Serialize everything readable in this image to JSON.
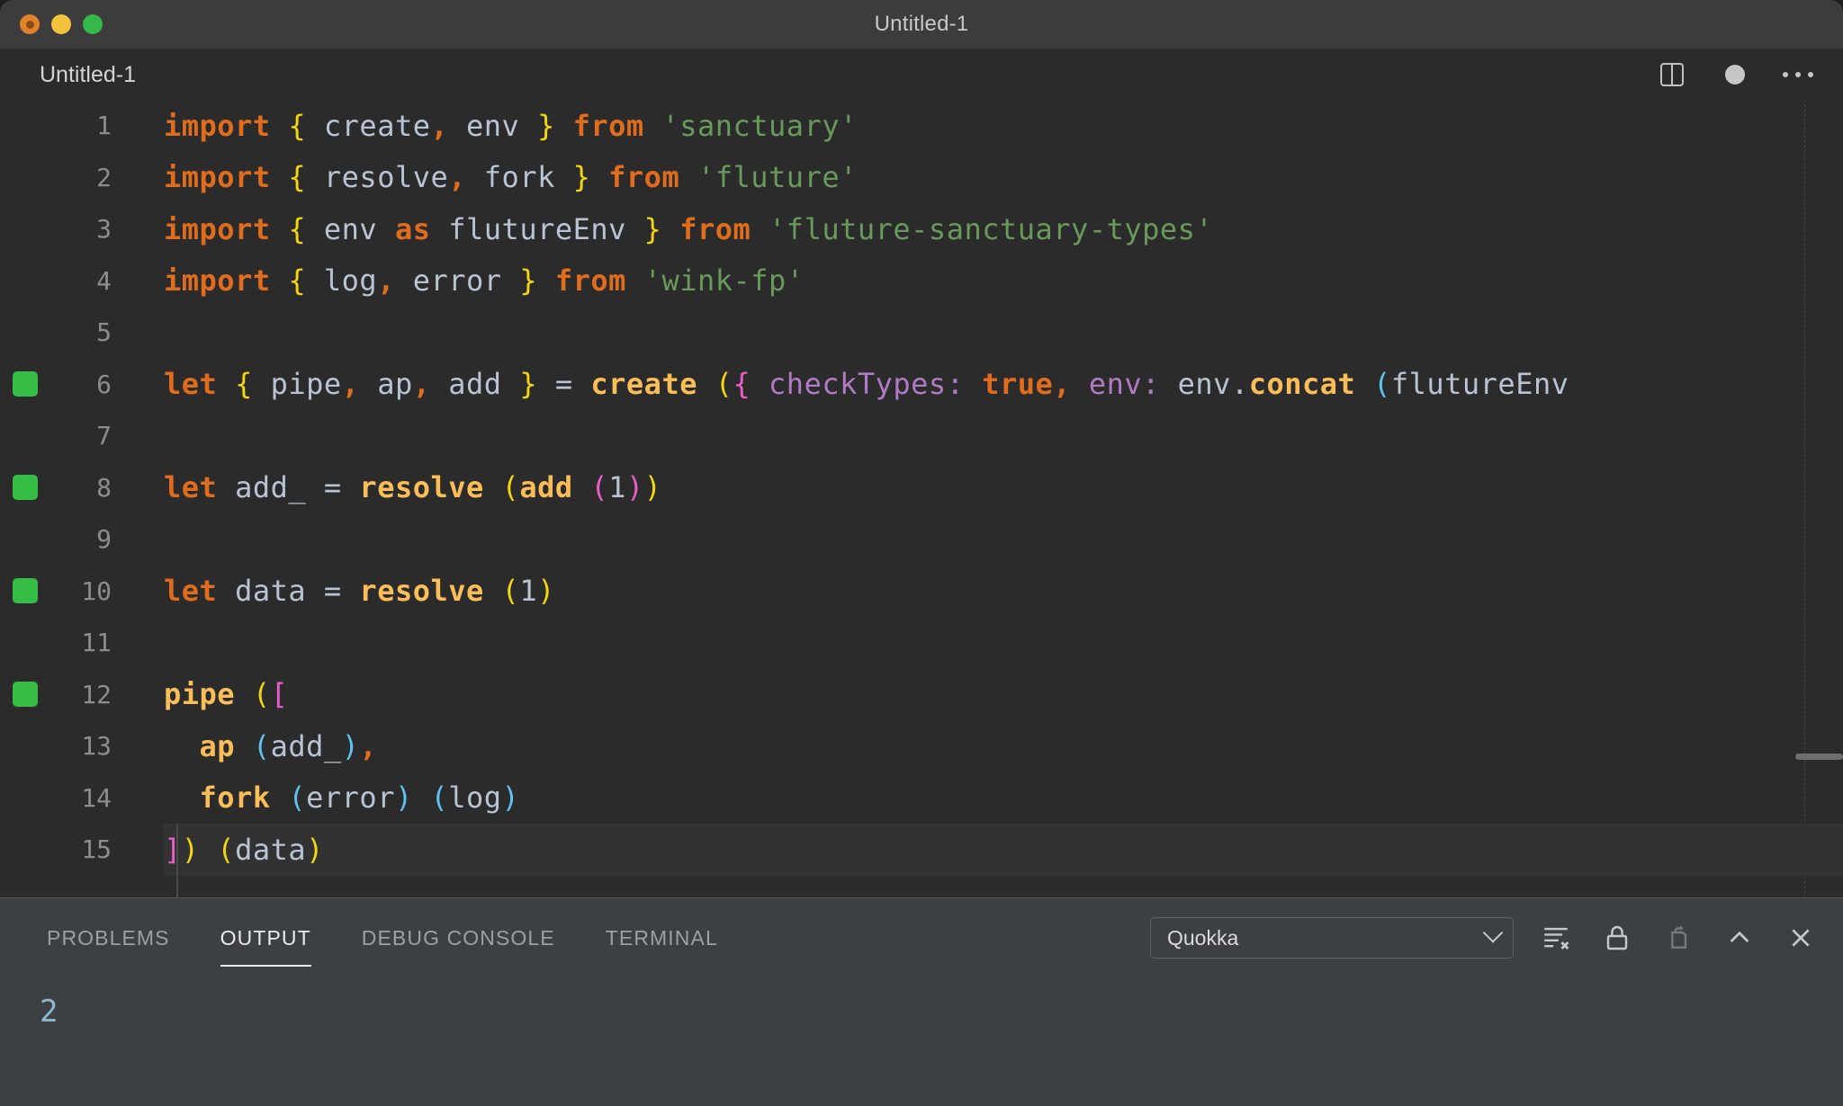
{
  "window": {
    "title": "Untitled-1",
    "traffic_lights": [
      {
        "name": "close",
        "color": "#e0822c"
      },
      {
        "name": "minimize",
        "color": "#f5c33b"
      },
      {
        "name": "maximize",
        "color": "#35b84a"
      }
    ]
  },
  "editor": {
    "tab_label": "Untitled-1",
    "actions": [
      {
        "name": "split-editor-icon",
        "label": "Split Editor"
      },
      {
        "name": "unsaved-indicator-icon",
        "label": "Unsaved"
      },
      {
        "name": "more-actions-icon",
        "label": "More Actions..."
      }
    ],
    "language": "javascript",
    "current_line": 15,
    "lines": [
      {
        "n": 1,
        "quokka": false,
        "tokens": [
          {
            "t": "import",
            "c": "t-kw"
          },
          {
            "t": " ",
            "c": "t-plain"
          },
          {
            "t": "{",
            "c": "b-yellow"
          },
          {
            "t": " create",
            "c": "t-plain"
          },
          {
            "t": ",",
            "c": "t-kw"
          },
          {
            "t": " env ",
            "c": "t-plain"
          },
          {
            "t": "}",
            "c": "b-yellow"
          },
          {
            "t": " ",
            "c": "t-plain"
          },
          {
            "t": "from",
            "c": "t-kw"
          },
          {
            "t": " ",
            "c": "t-plain"
          },
          {
            "t": "'sanctuary'",
            "c": "t-str"
          }
        ]
      },
      {
        "n": 2,
        "quokka": false,
        "tokens": [
          {
            "t": "import",
            "c": "t-kw"
          },
          {
            "t": " ",
            "c": "t-plain"
          },
          {
            "t": "{",
            "c": "b-yellow"
          },
          {
            "t": " resolve",
            "c": "t-plain"
          },
          {
            "t": ",",
            "c": "t-kw"
          },
          {
            "t": " fork ",
            "c": "t-plain"
          },
          {
            "t": "}",
            "c": "b-yellow"
          },
          {
            "t": " ",
            "c": "t-plain"
          },
          {
            "t": "from",
            "c": "t-kw"
          },
          {
            "t": " ",
            "c": "t-plain"
          },
          {
            "t": "'fluture'",
            "c": "t-str"
          }
        ]
      },
      {
        "n": 3,
        "quokka": false,
        "tokens": [
          {
            "t": "import",
            "c": "t-kw"
          },
          {
            "t": " ",
            "c": "t-plain"
          },
          {
            "t": "{",
            "c": "b-yellow"
          },
          {
            "t": " env ",
            "c": "t-plain"
          },
          {
            "t": "as",
            "c": "t-kw"
          },
          {
            "t": " flutureEnv ",
            "c": "t-plain"
          },
          {
            "t": "}",
            "c": "b-yellow"
          },
          {
            "t": " ",
            "c": "t-plain"
          },
          {
            "t": "from",
            "c": "t-kw"
          },
          {
            "t": " ",
            "c": "t-plain"
          },
          {
            "t": "'fluture-sanctuary-types'",
            "c": "t-str"
          }
        ]
      },
      {
        "n": 4,
        "quokka": false,
        "tokens": [
          {
            "t": "import",
            "c": "t-kw"
          },
          {
            "t": " ",
            "c": "t-plain"
          },
          {
            "t": "{",
            "c": "b-yellow"
          },
          {
            "t": " log",
            "c": "t-plain"
          },
          {
            "t": ",",
            "c": "t-kw"
          },
          {
            "t": " error ",
            "c": "t-plain"
          },
          {
            "t": "}",
            "c": "b-yellow"
          },
          {
            "t": " ",
            "c": "t-plain"
          },
          {
            "t": "from",
            "c": "t-kw"
          },
          {
            "t": " ",
            "c": "t-plain"
          },
          {
            "t": "'wink-fp'",
            "c": "t-str"
          }
        ]
      },
      {
        "n": 5,
        "quokka": false,
        "tokens": []
      },
      {
        "n": 6,
        "quokka": true,
        "tokens": [
          {
            "t": "let",
            "c": "t-kw"
          },
          {
            "t": " ",
            "c": "t-plain"
          },
          {
            "t": "{",
            "c": "b-yellow"
          },
          {
            "t": " pipe",
            "c": "t-plain"
          },
          {
            "t": ",",
            "c": "t-kw"
          },
          {
            "t": " ap",
            "c": "t-plain"
          },
          {
            "t": ",",
            "c": "t-kw"
          },
          {
            "t": " add ",
            "c": "t-plain"
          },
          {
            "t": "}",
            "c": "b-yellow"
          },
          {
            "t": " = ",
            "c": "t-op"
          },
          {
            "t": "create",
            "c": "t-fn"
          },
          {
            "t": " ",
            "c": "t-plain"
          },
          {
            "t": "(",
            "c": "b-yellow"
          },
          {
            "t": "{",
            "c": "b-magenta"
          },
          {
            "t": " ",
            "c": "t-plain"
          },
          {
            "t": "checkTypes",
            "c": "t-prop"
          },
          {
            "t": ": ",
            "c": "t-prop"
          },
          {
            "t": "true",
            "c": "t-kw"
          },
          {
            "t": ",",
            "c": "t-kw"
          },
          {
            "t": " ",
            "c": "t-plain"
          },
          {
            "t": "env",
            "c": "t-prop"
          },
          {
            "t": ": ",
            "c": "t-prop"
          },
          {
            "t": "env",
            "c": "t-plain"
          },
          {
            "t": ".",
            "c": "t-plain"
          },
          {
            "t": "concat",
            "c": "t-fn"
          },
          {
            "t": " ",
            "c": "t-plain"
          },
          {
            "t": "(",
            "c": "b-blue"
          },
          {
            "t": "flutureEnv",
            "c": "t-plain"
          }
        ]
      },
      {
        "n": 7,
        "quokka": false,
        "tokens": []
      },
      {
        "n": 8,
        "quokka": true,
        "tokens": [
          {
            "t": "let",
            "c": "t-kw"
          },
          {
            "t": " add_ ",
            "c": "t-plain"
          },
          {
            "t": "= ",
            "c": "t-op"
          },
          {
            "t": "resolve",
            "c": "t-fn"
          },
          {
            "t": " ",
            "c": "t-plain"
          },
          {
            "t": "(",
            "c": "b-yellow"
          },
          {
            "t": "add",
            "c": "t-fn"
          },
          {
            "t": " ",
            "c": "t-plain"
          },
          {
            "t": "(",
            "c": "b-magenta"
          },
          {
            "t": "1",
            "c": "t-num"
          },
          {
            "t": ")",
            "c": "b-magenta"
          },
          {
            "t": ")",
            "c": "b-yellow"
          }
        ]
      },
      {
        "n": 9,
        "quokka": false,
        "tokens": []
      },
      {
        "n": 10,
        "quokka": true,
        "tokens": [
          {
            "t": "let",
            "c": "t-kw"
          },
          {
            "t": " data ",
            "c": "t-plain"
          },
          {
            "t": "= ",
            "c": "t-op"
          },
          {
            "t": "resolve",
            "c": "t-fn"
          },
          {
            "t": " ",
            "c": "t-plain"
          },
          {
            "t": "(",
            "c": "b-yellow"
          },
          {
            "t": "1",
            "c": "t-num"
          },
          {
            "t": ")",
            "c": "b-yellow"
          }
        ]
      },
      {
        "n": 11,
        "quokka": false,
        "tokens": []
      },
      {
        "n": 12,
        "quokka": true,
        "tokens": [
          {
            "t": "pipe",
            "c": "t-fn"
          },
          {
            "t": " ",
            "c": "t-plain"
          },
          {
            "t": "(",
            "c": "b-yellow"
          },
          {
            "t": "[",
            "c": "b-magenta"
          }
        ]
      },
      {
        "n": 13,
        "quokka": false,
        "tokens": [
          {
            "t": "  ",
            "c": "t-plain"
          },
          {
            "t": "ap",
            "c": "t-fn"
          },
          {
            "t": " ",
            "c": "t-plain"
          },
          {
            "t": "(",
            "c": "b-blue"
          },
          {
            "t": "add_",
            "c": "t-plain"
          },
          {
            "t": ")",
            "c": "b-blue"
          },
          {
            "t": ",",
            "c": "t-kw"
          }
        ]
      },
      {
        "n": 14,
        "quokka": false,
        "tokens": [
          {
            "t": "  ",
            "c": "t-plain"
          },
          {
            "t": "fork",
            "c": "t-fn"
          },
          {
            "t": " ",
            "c": "t-plain"
          },
          {
            "t": "(",
            "c": "b-blue"
          },
          {
            "t": "error",
            "c": "t-plain"
          },
          {
            "t": ")",
            "c": "b-blue"
          },
          {
            "t": " ",
            "c": "t-plain"
          },
          {
            "t": "(",
            "c": "b-blue"
          },
          {
            "t": "log",
            "c": "t-plain"
          },
          {
            "t": ")",
            "c": "b-blue"
          }
        ]
      },
      {
        "n": 15,
        "quokka": false,
        "tokens": [
          {
            "t": "]",
            "c": "b-magenta"
          },
          {
            "t": ")",
            "c": "b-yellow"
          },
          {
            "t": " ",
            "c": "t-plain"
          },
          {
            "t": "(",
            "c": "b-yellow"
          },
          {
            "t": "data",
            "c": "t-plain"
          },
          {
            "t": ")",
            "c": "b-yellow"
          }
        ]
      }
    ]
  },
  "panel": {
    "tabs": [
      {
        "label": "PROBLEMS",
        "active": false
      },
      {
        "label": "OUTPUT",
        "active": true
      },
      {
        "label": "DEBUG CONSOLE",
        "active": false
      },
      {
        "label": "TERMINAL",
        "active": false
      }
    ],
    "channel_select": {
      "value": "Quokka"
    },
    "actions": [
      {
        "name": "clear-output-icon",
        "label": "Clear Output",
        "dim": false
      },
      {
        "name": "lock-scrolling-icon",
        "label": "Turn Auto Scrolling Off",
        "dim": false
      },
      {
        "name": "open-in-editor-icon",
        "label": "Open Output in Editor",
        "dim": true
      },
      {
        "name": "maximize-panel-icon",
        "label": "Maximize Panel Size",
        "dim": false
      },
      {
        "name": "close-panel-icon",
        "label": "Close Panel",
        "dim": false
      }
    ],
    "output_lines": [
      "2"
    ]
  },
  "colors": {
    "titlebar_bg": "#3c3c3c",
    "editor_bg": "#2b2b2b",
    "panel_bg": "#3c4043",
    "quokka_green": "#36bd45",
    "keyword": "#e06c1e",
    "string": "#679a5b",
    "function": "#fbbd58",
    "property": "#b07bc4",
    "plain": "#b8c4d4",
    "bracket_yellow": "#f3d512",
    "bracket_magenta": "#e85ec7",
    "bracket_blue": "#5ec2f0",
    "output_text": "#8fb7cf"
  }
}
